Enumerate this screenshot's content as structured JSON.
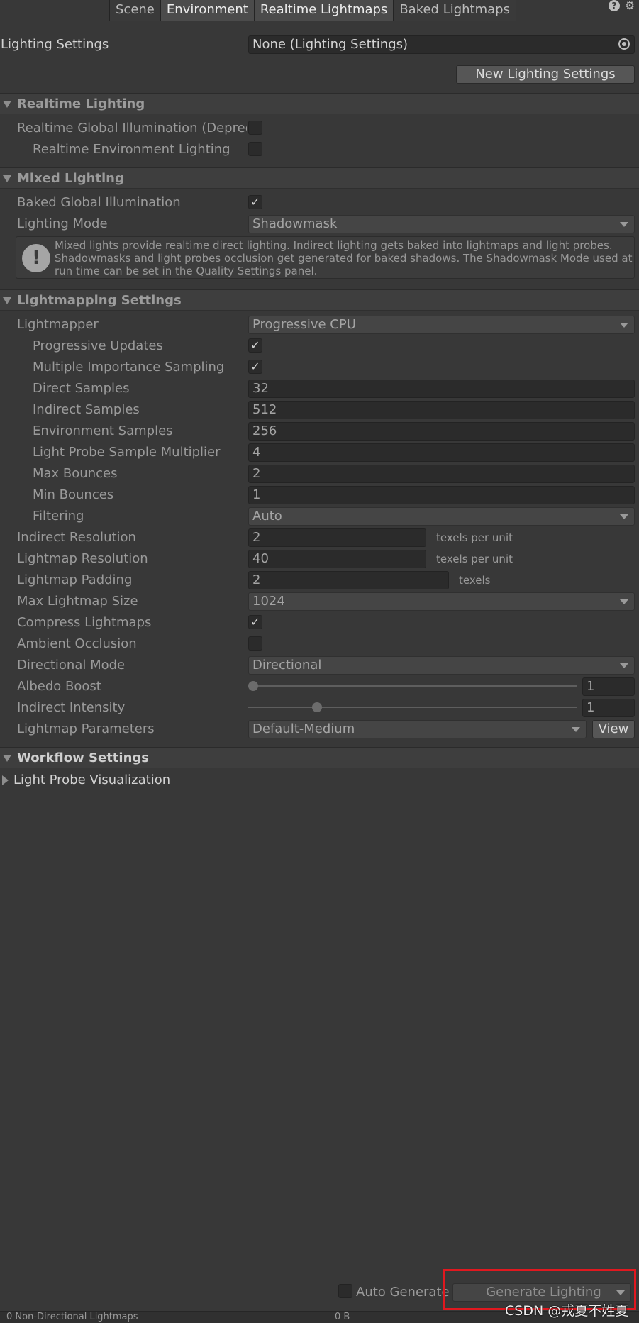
{
  "tabs": [
    {
      "label": "Scene"
    },
    {
      "label": "Environment"
    },
    {
      "label": "Realtime Lightmaps"
    },
    {
      "label": "Baked Lightmaps"
    }
  ],
  "lighting_settings": {
    "label": "Lighting Settings",
    "value": "None (Lighting Settings)",
    "new_button": "New Lighting Settings"
  },
  "realtime": {
    "header": "Realtime Lighting",
    "gi_label": "Realtime Global Illumination (Depreca",
    "gi_checked": "",
    "env_label": "Realtime Environment Lighting",
    "env_checked": ""
  },
  "mixed": {
    "header": "Mixed Lighting",
    "baked_gi_label": "Baked Global Illumination",
    "baked_gi_checked": "✓",
    "mode_label": "Lighting Mode",
    "mode_value": "Shadowmask",
    "info_text": "Mixed lights provide realtime direct lighting. Indirect lighting gets baked into lightmaps and light probes. Shadowmasks and light probes occlusion get generated for baked shadows. The Shadowmask Mode used at run time can be set in the Quality Settings panel."
  },
  "lightmapping": {
    "header": "Lightmapping Settings",
    "lightmapper_label": "Lightmapper",
    "lightmapper_value": "Progressive CPU",
    "progressive_updates_label": "Progressive Updates",
    "progressive_updates_checked": "✓",
    "mis_label": "Multiple Importance Sampling",
    "mis_checked": "✓",
    "direct_samples_label": "Direct Samples",
    "direct_samples": "32",
    "indirect_samples_label": "Indirect Samples",
    "indirect_samples": "512",
    "environment_samples_label": "Environment Samples",
    "environment_samples": "256",
    "probe_multiplier_label": "Light Probe Sample Multiplier",
    "probe_multiplier": "4",
    "max_bounces_label": "Max Bounces",
    "max_bounces": "2",
    "min_bounces_label": "Min Bounces",
    "min_bounces": "1",
    "filtering_label": "Filtering",
    "filtering_value": "Auto",
    "indirect_resolution_label": "Indirect Resolution",
    "indirect_resolution": "2",
    "indirect_resolution_unit": "texels per unit",
    "lightmap_resolution_label": "Lightmap Resolution",
    "lightmap_resolution": "40",
    "lightmap_resolution_unit": "texels per unit",
    "lightmap_padding_label": "Lightmap Padding",
    "lightmap_padding": "2",
    "lightmap_padding_unit": "texels",
    "max_size_label": "Max Lightmap Size",
    "max_size_value": "1024",
    "compress_label": "Compress Lightmaps",
    "compress_checked": "✓",
    "ao_label": "Ambient Occlusion",
    "ao_checked": "",
    "directional_label": "Directional Mode",
    "directional_value": "Directional",
    "albedo_label": "Albedo Boost",
    "albedo_value": "1",
    "albedo_slider_fraction": 0,
    "indirect_intensity_label": "Indirect Intensity",
    "indirect_intensity_value": "1",
    "indirect_intensity_slider_fraction": 0.2,
    "params_label": "Lightmap Parameters",
    "params_value": "Default-Medium",
    "view_button": "View"
  },
  "workflow": {
    "header": "Workflow Settings",
    "probe_vis_label": "Light Probe Visualization"
  },
  "bottom": {
    "auto_generate_label": "Auto Generate",
    "auto_generate_checked": "",
    "generate_button": "Generate Lighting",
    "watermark": "CSDN @戎夏不姓夏",
    "stats_label": "0 Non-Directional Lightmaps",
    "stats_value": "0 B"
  }
}
